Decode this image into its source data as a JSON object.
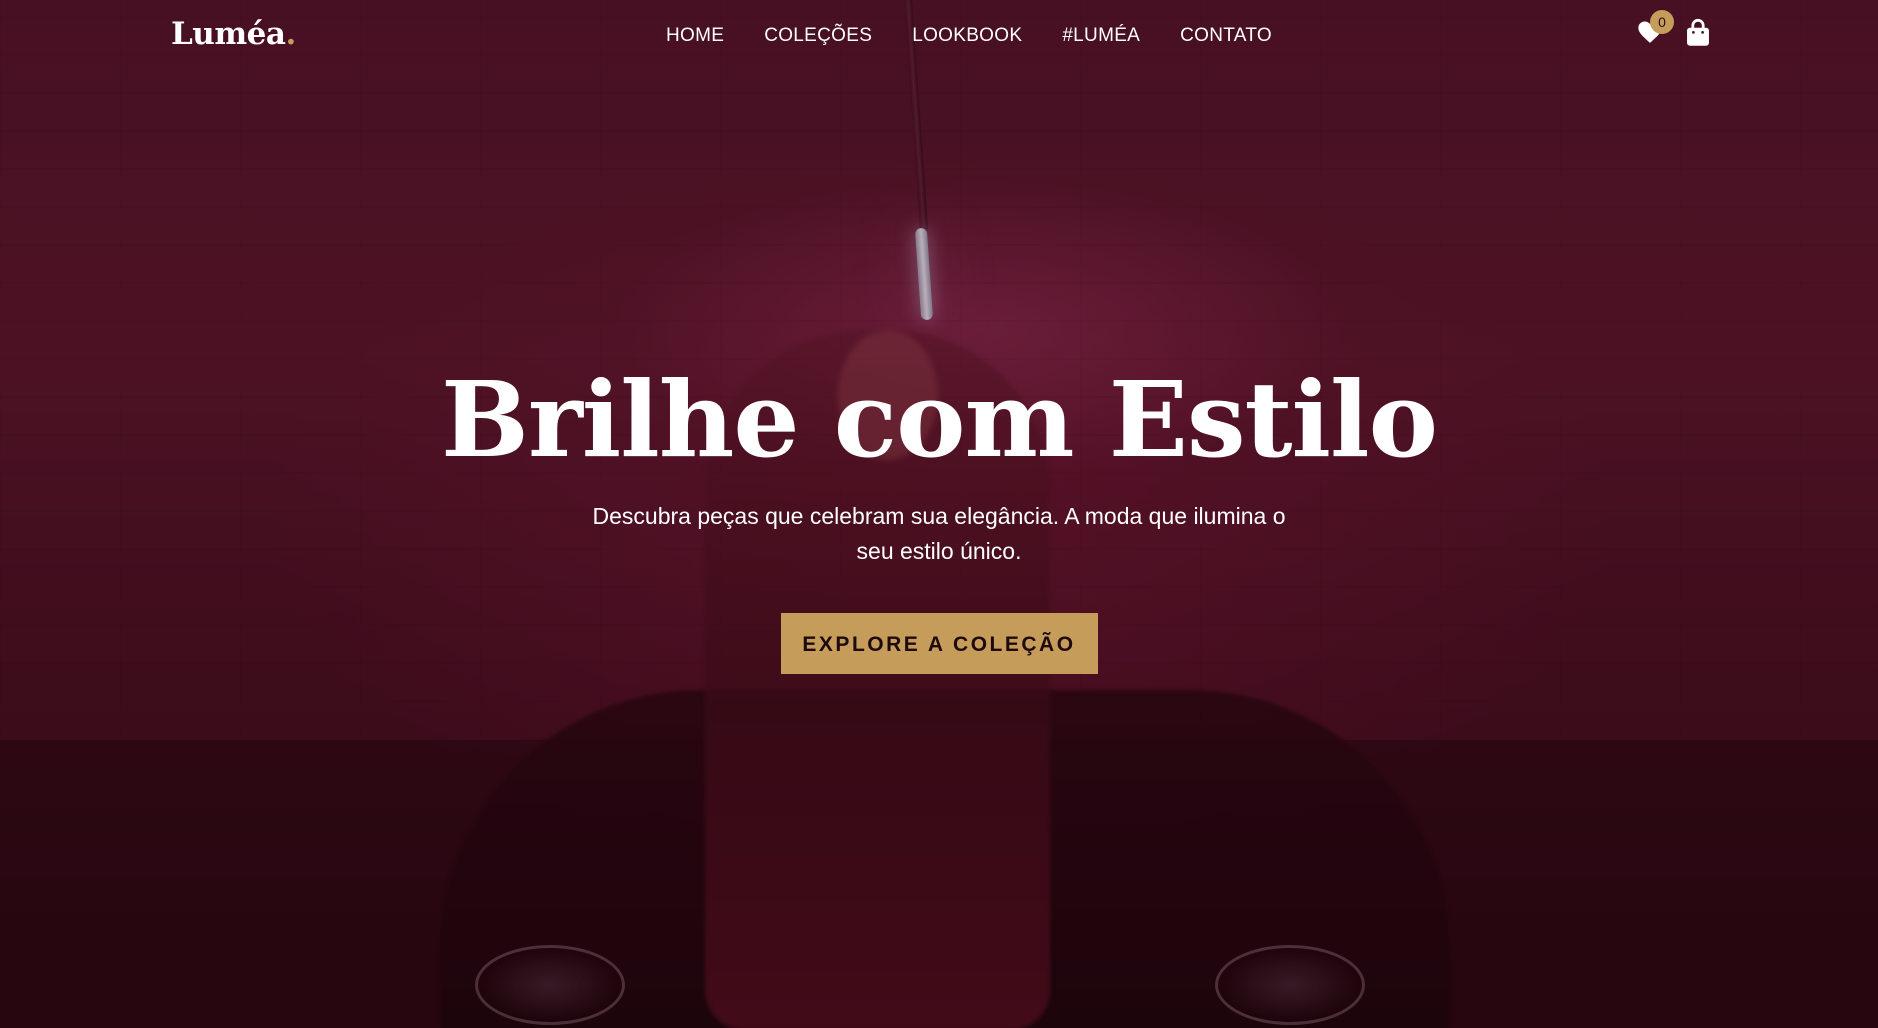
{
  "brand": {
    "name": "Luméa",
    "dot": ".",
    "accent_color": "#c69c5a"
  },
  "nav": {
    "items": [
      {
        "label": "HOME"
      },
      {
        "label": "COLEÇÕES"
      },
      {
        "label": "LOOKBOOK"
      },
      {
        "label": "#LUMÉA"
      },
      {
        "label": "CONTATO"
      }
    ]
  },
  "icons": {
    "wishlist": {
      "icon": "heart-icon",
      "count": "0"
    },
    "cart": {
      "icon": "shopping-bag-icon"
    }
  },
  "hero": {
    "title": "Brilhe com Estilo",
    "subtitle": "Descubra peças que celebram sua elegância. A moda que ilumina o seu estilo único.",
    "cta_label": "EXPLORE A COLEÇÃO",
    "background": "video-still-woman-leaning-on-car-in-red-lit-garage",
    "overlay_color": "#4a1326"
  }
}
